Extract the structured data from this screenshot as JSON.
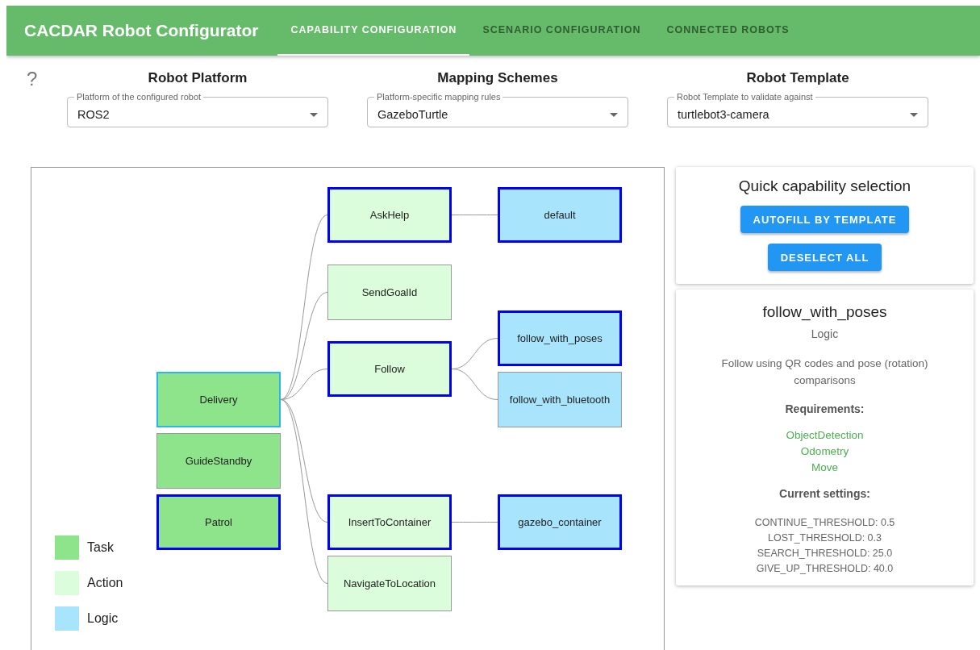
{
  "app": {
    "title": "CACDAR Robot Configurator"
  },
  "tabs": [
    {
      "label": "CAPABILITY CONFIGURATION",
      "selected": true
    },
    {
      "label": "SCENARIO CONFIGURATION",
      "selected": false
    },
    {
      "label": "CONNECTED ROBOTS",
      "selected": false
    }
  ],
  "help": {
    "symbol": "?"
  },
  "selectors": [
    {
      "heading": "Robot Platform",
      "label": "Platform of the configured robot",
      "value": "ROS2"
    },
    {
      "heading": "Mapping Schemes",
      "label": "Platform-specific mapping rules",
      "value": "GazeboTurtle"
    },
    {
      "heading": "Robot Template",
      "label": "Robot Template to validate against",
      "value": "turtlebot3-camera"
    }
  ],
  "graph": {
    "tasks": [
      {
        "label": "Delivery",
        "kind": "task",
        "selected": false,
        "highlighted": true,
        "children": [
          {
            "label": "AskHelp",
            "kind": "action",
            "selected": true,
            "children": [
              {
                "label": "default",
                "kind": "logic",
                "selected": true
              }
            ]
          },
          {
            "label": "SendGoalId",
            "kind": "action",
            "selected": false
          },
          {
            "label": "Follow",
            "kind": "action",
            "selected": true,
            "children": [
              {
                "label": "follow_with_poses",
                "kind": "logic",
                "selected": true
              },
              {
                "label": "follow_with_bluetooth",
                "kind": "logic",
                "selected": false
              }
            ]
          },
          {
            "label": "InsertToContainer",
            "kind": "action",
            "selected": true,
            "children": [
              {
                "label": "gazebo_container",
                "kind": "logic",
                "selected": true
              }
            ]
          },
          {
            "label": "NavigateToLocation",
            "kind": "action",
            "selected": false
          }
        ]
      },
      {
        "label": "GuideStandby",
        "kind": "task",
        "selected": false,
        "highlighted": false
      },
      {
        "label": "Patrol",
        "kind": "task",
        "selected": true,
        "highlighted": false
      }
    ],
    "legend": [
      {
        "kind": "task",
        "label": "Task"
      },
      {
        "kind": "action",
        "label": "Action"
      },
      {
        "kind": "logic",
        "label": "Logic"
      }
    ]
  },
  "quick_selection": {
    "title": "Quick capability selection",
    "buttons": [
      "AUTOFILL BY TEMPLATE",
      "DESELECT ALL"
    ]
  },
  "details": {
    "title": "follow_with_poses",
    "type": "Logic",
    "description": "Follow using QR codes and pose (rotation) comparisons",
    "requirements_heading": "Requirements:",
    "requirements": [
      "ObjectDetection",
      "Odometry",
      "Move"
    ],
    "settings_heading": "Current settings:",
    "settings": [
      "CONTINUE_THRESHOLD: 0.5",
      "LOST_THRESHOLD: 0.3",
      "SEARCH_THRESHOLD: 25.0",
      "GIVE_UP_THRESHOLD: 40.0"
    ]
  }
}
